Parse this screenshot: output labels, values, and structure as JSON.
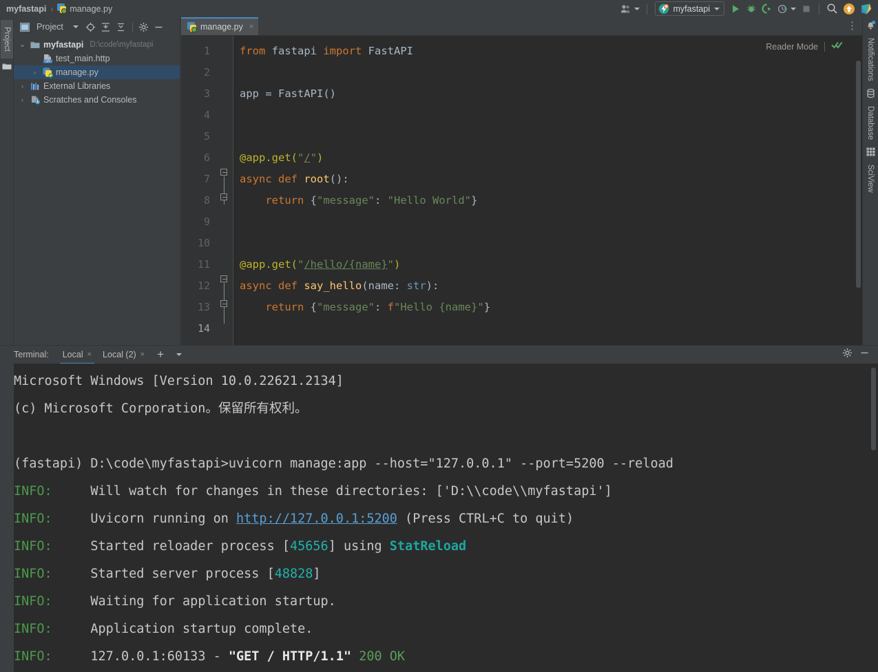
{
  "titlebar": {
    "breadcrumb": {
      "project": "myfastapi",
      "separator": "›",
      "file": "manage.py"
    },
    "icons": {
      "user": "user-group-icon",
      "run": "run-icon",
      "debug": "debug-icon",
      "coverage": "run-with-coverage-icon",
      "profile": "profile-icon",
      "stop": "stop-icon",
      "search": "search-icon",
      "update": "update-icon",
      "ide": "ide-icon"
    },
    "run_config": {
      "name": "myfastapi",
      "icon": "fastapi-config-icon"
    }
  },
  "left_strip": {
    "project_label": "Project",
    "folder_icon": "folder-icon"
  },
  "project_panel": {
    "title": "Project",
    "buttons": [
      "locate-icon",
      "expand-all-icon",
      "collapse-all-icon",
      "gear-icon",
      "hide-icon"
    ],
    "tree": [
      {
        "indent": 0,
        "arrow": "⌄",
        "expanded": true,
        "icon": "folder-icon",
        "label": "myfastapi",
        "bold": true,
        "path": "D:\\code\\myfastapi",
        "selected": false
      },
      {
        "indent": 1,
        "arrow": "",
        "expanded": false,
        "icon": "http-file-icon",
        "label": "test_main.http",
        "bold": false,
        "path": "",
        "selected": false
      },
      {
        "indent": 1,
        "arrow": "›",
        "expanded": false,
        "icon": "python-file-icon",
        "label": "manage.py",
        "bold": false,
        "path": "",
        "selected": true
      },
      {
        "indent": 0,
        "arrow": "›",
        "expanded": false,
        "icon": "library-icon",
        "label": "External Libraries",
        "bold": false,
        "path": "",
        "selected": false
      },
      {
        "indent": 0,
        "arrow": "›",
        "expanded": false,
        "icon": "scratches-icon",
        "label": "Scratches and Consoles",
        "bold": false,
        "path": "",
        "selected": false
      }
    ]
  },
  "editor": {
    "tab": {
      "label": "manage.py",
      "icon": "python-file-icon",
      "close": "×"
    },
    "reader_mode": {
      "label": "Reader Mode",
      "inspection_icon": "inspections-ok-icon"
    },
    "gutter_icon": "more-icon",
    "lines": [
      {
        "n": "1",
        "tokens": [
          {
            "t": "from ",
            "c": "k"
          },
          {
            "t": "fastapi ",
            "c": "pl"
          },
          {
            "t": "import ",
            "c": "k"
          },
          {
            "t": "FastAPI",
            "c": "pl"
          }
        ]
      },
      {
        "n": "2",
        "tokens": []
      },
      {
        "n": "3",
        "tokens": [
          {
            "t": "app = FastAPI()",
            "c": "pl"
          }
        ]
      },
      {
        "n": "4",
        "tokens": []
      },
      {
        "n": "5",
        "tokens": []
      },
      {
        "n": "6",
        "tokens": [
          {
            "t": "@app.get(",
            "c": "deco"
          },
          {
            "t": "\"",
            "c": "str"
          },
          {
            "t": "/",
            "c": "strlink"
          },
          {
            "t": "\"",
            "c": "str"
          },
          {
            "t": ")",
            "c": "deco"
          }
        ]
      },
      {
        "n": "7",
        "tokens": [
          {
            "t": "async def ",
            "c": "k"
          },
          {
            "t": "root",
            "c": "fn"
          },
          {
            "t": "():",
            "c": "pl"
          }
        ]
      },
      {
        "n": "8",
        "tokens": [
          {
            "t": "    ",
            "c": "pl"
          },
          {
            "t": "return ",
            "c": "k"
          },
          {
            "t": "{",
            "c": "pl"
          },
          {
            "t": "\"message\"",
            "c": "str"
          },
          {
            "t": ": ",
            "c": "pl"
          },
          {
            "t": "\"Hello World\"",
            "c": "str"
          },
          {
            "t": "}",
            "c": "pl"
          }
        ]
      },
      {
        "n": "9",
        "tokens": []
      },
      {
        "n": "10",
        "tokens": []
      },
      {
        "n": "11",
        "tokens": [
          {
            "t": "@app.get(",
            "c": "deco"
          },
          {
            "t": "\"",
            "c": "str"
          },
          {
            "t": "/hello/{name}",
            "c": "strlink"
          },
          {
            "t": "\"",
            "c": "str"
          },
          {
            "t": ")",
            "c": "deco"
          }
        ]
      },
      {
        "n": "12",
        "tokens": [
          {
            "t": "async def ",
            "c": "k"
          },
          {
            "t": "say_hello",
            "c": "fn"
          },
          {
            "t": "(name: ",
            "c": "pl"
          },
          {
            "t": "str",
            "c": "typ"
          },
          {
            "t": "):",
            "c": "pl"
          }
        ]
      },
      {
        "n": "13",
        "tokens": [
          {
            "t": "    ",
            "c": "pl"
          },
          {
            "t": "return ",
            "c": "k"
          },
          {
            "t": "{",
            "c": "pl"
          },
          {
            "t": "\"message\"",
            "c": "str"
          },
          {
            "t": ": ",
            "c": "pl"
          },
          {
            "t": "f",
            "c": "k"
          },
          {
            "t": "\"Hello ",
            "c": "str"
          },
          {
            "t": "{name}",
            "c": "str"
          },
          {
            "t": "\"",
            "c": "str"
          },
          {
            "t": "}",
            "c": "pl"
          }
        ]
      },
      {
        "n": "14",
        "tokens": []
      }
    ]
  },
  "right_strip": {
    "items": [
      {
        "label": "Notifications",
        "icon": "bell-icon",
        "badge": true
      },
      {
        "label": "Database",
        "icon": "database-icon",
        "badge": false
      },
      {
        "label": "SciView",
        "icon": "sciview-icon",
        "badge": false
      }
    ]
  },
  "terminal": {
    "label": "Terminal:",
    "tabs": [
      {
        "label": "Local",
        "active": true,
        "close": "×"
      },
      {
        "label": "Local (2)",
        "active": false,
        "close": "×"
      }
    ],
    "add_button": "+",
    "dropdown_button": "⌄",
    "settings_icon": "gear-icon",
    "hide_icon": "hide-icon",
    "lines": [
      {
        "segs": [
          {
            "t": "Microsoft Windows [Version 10.0.22621.2134]",
            "c": "t-white"
          }
        ]
      },
      {
        "segs": [
          {
            "t": "(c) Microsoft Corporation。保留所有权利。",
            "c": "t-white"
          }
        ]
      },
      {
        "segs": []
      },
      {
        "segs": [
          {
            "t": "(fastapi) D:\\code\\myfastapi>uvicorn manage:app --host=\"127.0.0.1\" --port=5200 --reload",
            "c": "t-white"
          }
        ]
      },
      {
        "segs": [
          {
            "t": "INFO:",
            "c": "t-info"
          },
          {
            "t": "     Will watch for changes in these directories: ['D:\\\\code\\\\myfastapi']",
            "c": "t-white"
          }
        ]
      },
      {
        "segs": [
          {
            "t": "INFO:",
            "c": "t-info"
          },
          {
            "t": "     Uvicorn running on ",
            "c": "t-white"
          },
          {
            "t": "http://127.0.0.1:5200",
            "c": "t-link"
          },
          {
            "t": " (Press CTRL+C to quit)",
            "c": "t-white"
          }
        ]
      },
      {
        "segs": [
          {
            "t": "INFO:",
            "c": "t-info"
          },
          {
            "t": "     Started reloader process [",
            "c": "t-white"
          },
          {
            "t": "45656",
            "c": "t-cyan"
          },
          {
            "t": "] using ",
            "c": "t-white"
          },
          {
            "t": "StatReload",
            "c": "t-cyanb"
          }
        ]
      },
      {
        "segs": [
          {
            "t": "INFO:",
            "c": "t-info"
          },
          {
            "t": "     Started server process [",
            "c": "t-white"
          },
          {
            "t": "48828",
            "c": "t-cyan"
          },
          {
            "t": "]",
            "c": "t-white"
          }
        ]
      },
      {
        "segs": [
          {
            "t": "INFO:",
            "c": "t-info"
          },
          {
            "t": "     Waiting for application startup.",
            "c": "t-white"
          }
        ]
      },
      {
        "segs": [
          {
            "t": "INFO:",
            "c": "t-info"
          },
          {
            "t": "     Application startup complete.",
            "c": "t-white"
          }
        ]
      },
      {
        "segs": [
          {
            "t": "INFO:",
            "c": "t-info"
          },
          {
            "t": "     127.0.0.1:60133 - ",
            "c": "t-white"
          },
          {
            "t": "\"GET / HTTP/1.1\"",
            "c": "t-bold"
          },
          {
            "t": " 200 OK",
            "c": "t-green"
          }
        ]
      }
    ]
  },
  "colors": {
    "panel_bg": "#3c3f41",
    "editor_bg": "#2b2b2b",
    "gutter_bg": "#313335",
    "selection_blue": "#2f4b66",
    "accent_blue": "#4a88c7",
    "info_green": "#4c9a4c",
    "link_blue": "#5a9fd4",
    "keyword_orange": "#cc7832",
    "string_green": "#6a8759",
    "decorator_yellow": "#bbb529"
  }
}
